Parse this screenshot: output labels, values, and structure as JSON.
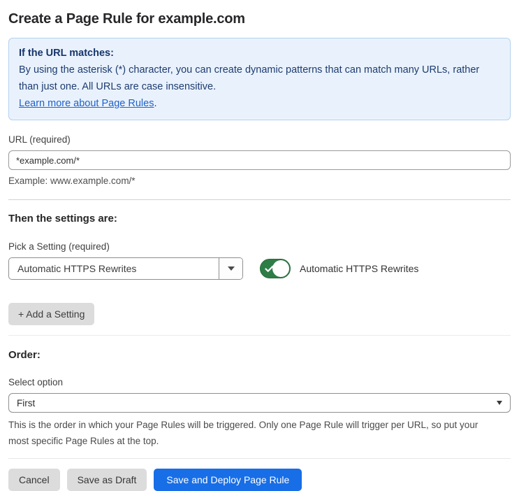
{
  "page": {
    "title": "Create a Page Rule for example.com"
  },
  "info_box": {
    "heading": "If the URL matches:",
    "body": "By using the asterisk (*) character, you can create dynamic patterns that can match many URLs, rather than just one. All URLs are case insensitive.",
    "link_label": "Learn more about Page Rules",
    "link_suffix": "."
  },
  "url_field": {
    "label": "URL (required)",
    "value": "*example.com/*",
    "helper": "Example: www.example.com/*"
  },
  "settings_section": {
    "heading": "Then the settings are:",
    "picker_label": "Pick a Setting (required)",
    "picker_value": "Automatic HTTPS Rewrites",
    "toggle_state": "on",
    "toggle_label": "Automatic HTTPS Rewrites",
    "add_setting_label": "+ Add a Setting"
  },
  "order_section": {
    "heading": "Order:",
    "label": "Select option",
    "value": "First",
    "helper": "This is the order in which your Page Rules will be triggered. Only one Page Rule will trigger per URL, so put your most specific Page Rules at the top."
  },
  "actions": {
    "cancel_label": "Cancel",
    "save_draft_label": "Save as Draft",
    "save_deploy_label": "Save and Deploy Page Rule"
  },
  "colors": {
    "primary_blue": "#186ee6",
    "link_blue": "#2061c9",
    "info_bg": "#e9f2fc",
    "info_border": "#b3d2f0",
    "info_text": "#1e3b70",
    "toggle_green": "#2d7e46",
    "button_gray": "#dcdcdc"
  }
}
